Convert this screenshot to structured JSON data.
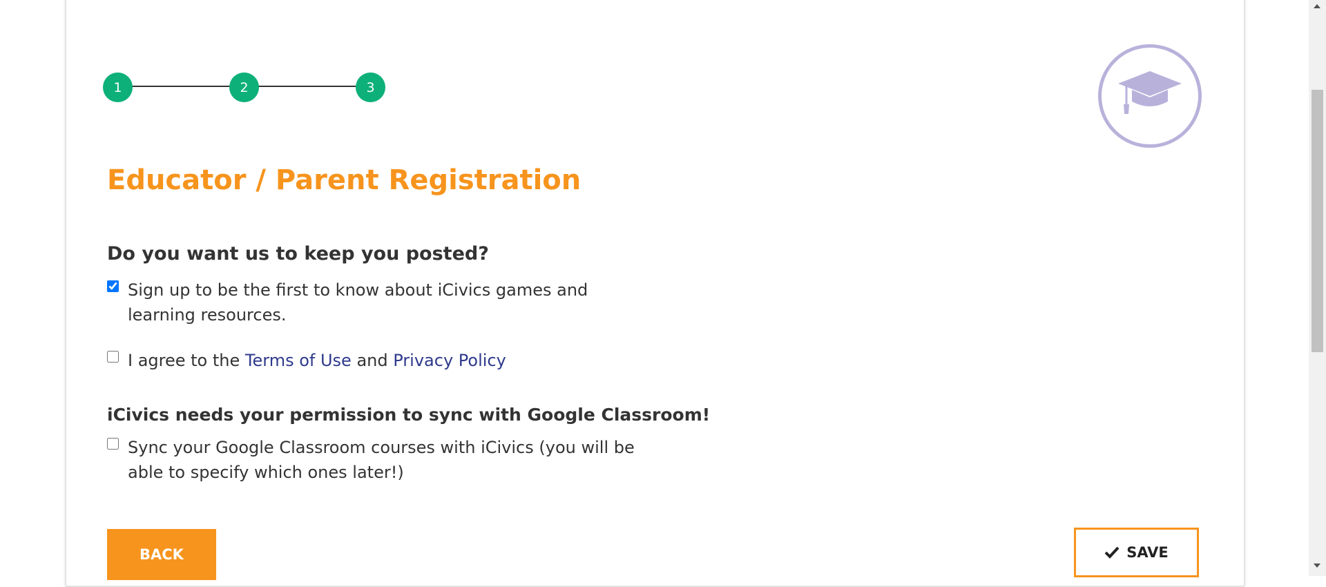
{
  "stepper": {
    "steps": [
      "1",
      "2",
      "3"
    ],
    "active_color": "#0db079"
  },
  "icon": {
    "name": "graduation-cap-icon",
    "color": "#b8b2db"
  },
  "form": {
    "title": "Educator / Parent Registration",
    "newsletter_heading": "Do you want us to keep you posted?",
    "newsletter_label": "Sign up to be the first to know about iCivics games and learning resources.",
    "newsletter_checked": true,
    "terms_prefix": "I agree to the",
    "terms_link": "Terms of Use",
    "terms_and": "and",
    "privacy_link": "Privacy Policy",
    "terms_checked": false,
    "google_heading": "iCivics needs your permission to sync with Google Classroom!",
    "google_label": "Sync your Google Classroom courses with iCivics (you will be able to specify which ones later!)",
    "google_checked": false
  },
  "buttons": {
    "back": "BACK",
    "save": "SAVE",
    "save_icon": "checkmark-icon"
  },
  "colors": {
    "accent": "#f7941d",
    "link": "#2e3a8c",
    "text": "#333333"
  }
}
